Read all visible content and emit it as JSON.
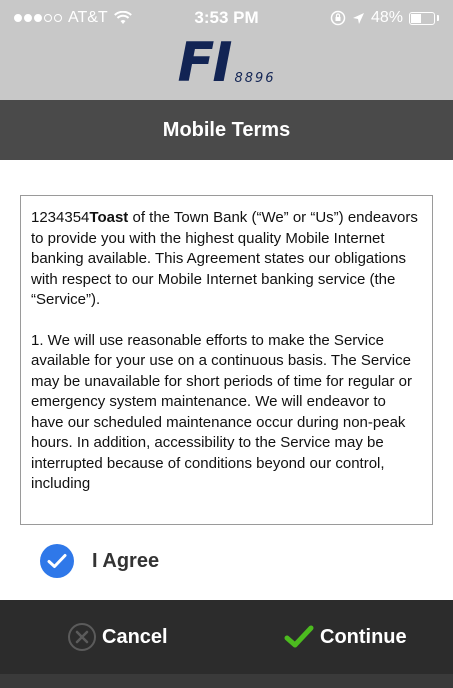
{
  "status_bar": {
    "carrier": "AT&T",
    "time": "3:53 PM",
    "battery": "48%",
    "battery_level": 0.48
  },
  "header": {
    "logo_main": "FI",
    "logo_number": "8896"
  },
  "title_bar": {
    "title": "Mobile Terms"
  },
  "terms": {
    "p1_prefix": "1234354",
    "p1_bold": "Toast",
    "p1_rest": " of the Town Bank (“We” or “Us”) endeavors to provide you with the highest quality Mobile Internet banking available. This Agreement states our obligations with respect to our Mobile Internet banking service (the “Service”).",
    "p2": "1. We will use reasonable efforts to make the Service available for your use on a continuous basis. The Service may be unavailable for short periods of time for regular or emergency system maintenance. We will endeavor to have our scheduled maintenance occur during non-peak hours. In addition, accessibility to the Service may be interrupted because of conditions beyond our control, including"
  },
  "agree": {
    "label": "I Agree",
    "checked": true
  },
  "actions": {
    "cancel_label": "Cancel",
    "continue_label": "Continue"
  },
  "colors": {
    "accent_blue": "#2f78e9",
    "continue_green": "#4cbb1f",
    "logo_navy": "#122454",
    "title_bar": "#4a4a4a",
    "action_bar": "#2c2c2c"
  }
}
